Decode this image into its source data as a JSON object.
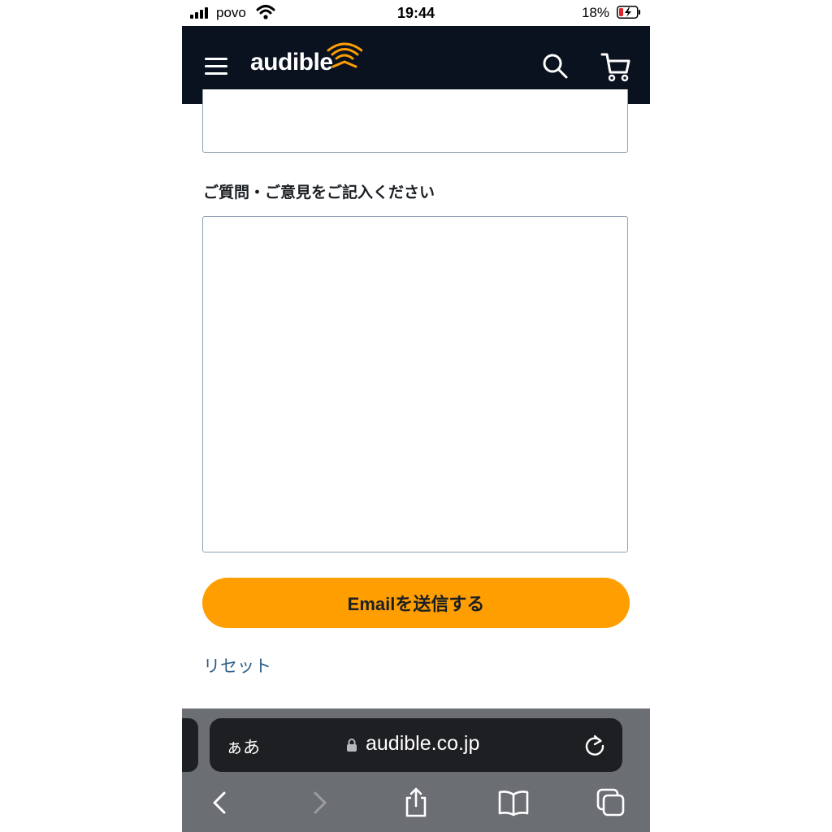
{
  "status_bar": {
    "carrier": "povo",
    "time": "19:44",
    "battery_percent": "18%"
  },
  "nav": {
    "logo_text": "audible",
    "icons": [
      "menu-icon",
      "search-icon",
      "cart-icon"
    ]
  },
  "form": {
    "message_label": "ご質問・ご意見をご記入ください",
    "message_value": "",
    "submit_label": "Emailを送信する",
    "reset_label": "リセット"
  },
  "browser": {
    "text_size_label": "ぁあ",
    "url": "audible.co.jp",
    "icons": [
      "back-icon",
      "forward-icon",
      "share-icon",
      "bookmarks-icon",
      "tabs-icon",
      "reload-icon",
      "lock-icon"
    ]
  },
  "colors": {
    "nav_background": "#0a1220",
    "brand_orange": "#ff9e00",
    "link": "#2b5f8a",
    "battery_low": "#e0262b"
  }
}
